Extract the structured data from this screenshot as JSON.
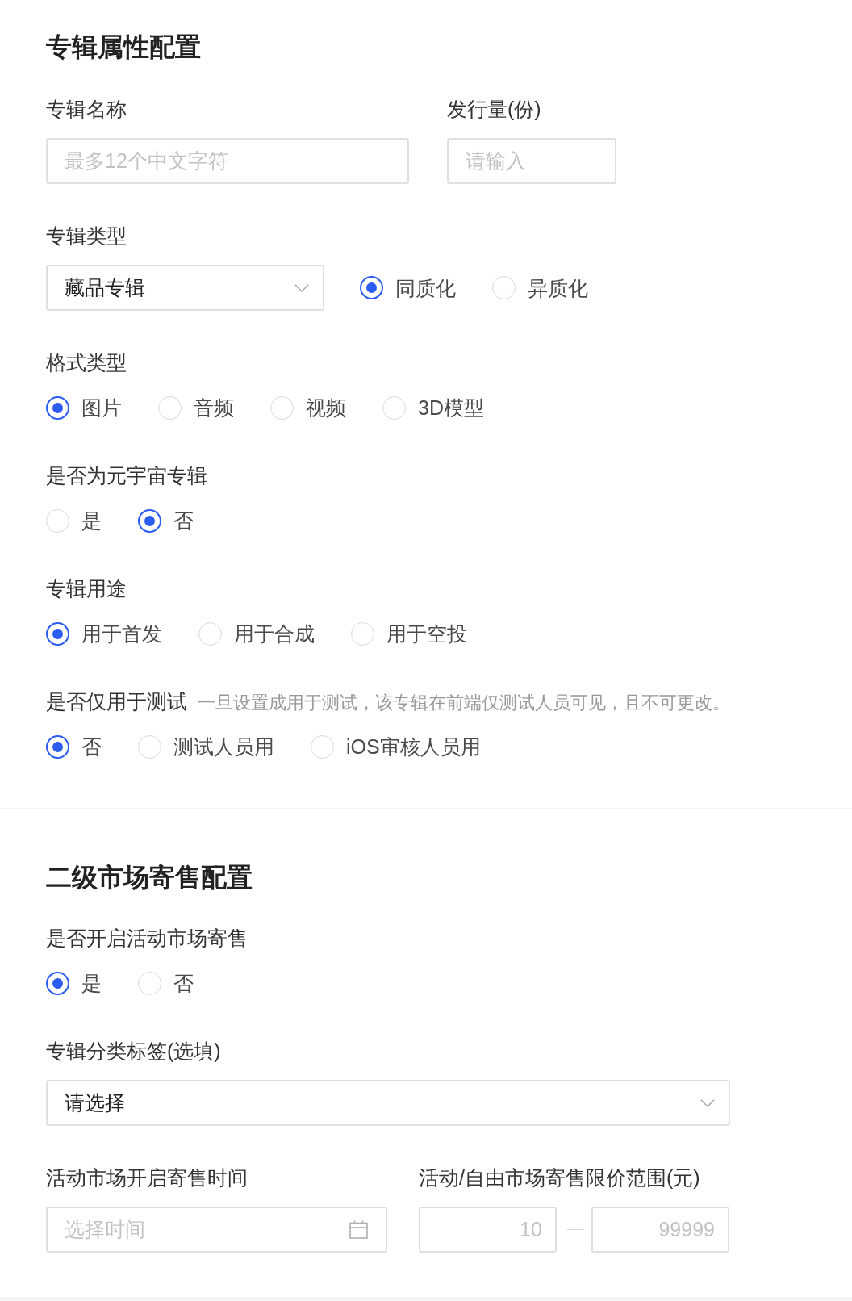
{
  "sections": [
    {
      "title": "专辑属性配置",
      "rows": [
        {
          "fields": [
            {
              "label": "专辑名称",
              "controls": [
                {
                  "kind": "input",
                  "placeholder": "最多12个中文字符"
                }
              ]
            },
            {
              "label": "发行量(份)",
              "controls": [
                {
                  "kind": "input",
                  "placeholder": "请输入"
                }
              ]
            }
          ]
        },
        {
          "fields": [
            {
              "label": "专辑类型",
              "controls": [
                {
                  "kind": "select",
                  "value": "藏品专辑"
                },
                {
                  "kind": "radios",
                  "options": [
                    {
                      "label": "同质化",
                      "selected": true
                    },
                    {
                      "label": "异质化",
                      "selected": false
                    }
                  ]
                }
              ]
            }
          ]
        },
        {
          "fields": [
            {
              "label": "格式类型",
              "controls": [
                {
                  "kind": "radios",
                  "options": [
                    {
                      "label": "图片",
                      "selected": true
                    },
                    {
                      "label": "音频",
                      "selected": false
                    },
                    {
                      "label": "视频",
                      "selected": false
                    },
                    {
                      "label": "3D模型",
                      "selected": false
                    }
                  ]
                }
              ]
            }
          ]
        },
        {
          "fields": [
            {
              "label": "是否为元宇宙专辑",
              "controls": [
                {
                  "kind": "radios",
                  "options": [
                    {
                      "label": "是",
                      "selected": false
                    },
                    {
                      "label": "否",
                      "selected": true
                    }
                  ]
                }
              ]
            }
          ]
        },
        {
          "fields": [
            {
              "label": "专辑用途",
              "controls": [
                {
                  "kind": "radios",
                  "options": [
                    {
                      "label": "用于首发",
                      "selected": true
                    },
                    {
                      "label": "用于合成",
                      "selected": false
                    },
                    {
                      "label": "用于空投",
                      "selected": false
                    }
                  ]
                }
              ]
            }
          ]
        },
        {
          "fields": [
            {
              "label": "是否仅用于测试",
              "hint": "一旦设置成用于测试，该专辑在前端仅测试人员可见，且不可更改。",
              "controls": [
                {
                  "kind": "radios",
                  "options": [
                    {
                      "label": "否",
                      "selected": true
                    },
                    {
                      "label": "测试人员用",
                      "selected": false
                    },
                    {
                      "label": "iOS审核人员用",
                      "selected": false
                    }
                  ]
                }
              ]
            }
          ]
        }
      ]
    },
    {
      "title": "二级市场寄售配置",
      "rows": [
        {
          "fields": [
            {
              "label": "是否开启活动市场寄售",
              "controls": [
                {
                  "kind": "radios",
                  "options": [
                    {
                      "label": "是",
                      "selected": true
                    },
                    {
                      "label": "否",
                      "selected": false
                    }
                  ]
                }
              ]
            }
          ]
        },
        {
          "fields": [
            {
              "label": "专辑分类标签(选填)",
              "controls": [
                {
                  "kind": "select",
                  "value": "请选择"
                }
              ]
            }
          ]
        },
        {
          "fields": [
            {
              "label": "活动市场开启寄售时间",
              "controls": [
                {
                  "kind": "date",
                  "placeholder": "选择时间"
                }
              ]
            },
            {
              "label": "活动/自由市场寄售限价范围(元)",
              "controls": [
                {
                  "kind": "range",
                  "min_placeholder": "10",
                  "max_placeholder": "99999"
                }
              ]
            }
          ]
        }
      ]
    }
  ]
}
